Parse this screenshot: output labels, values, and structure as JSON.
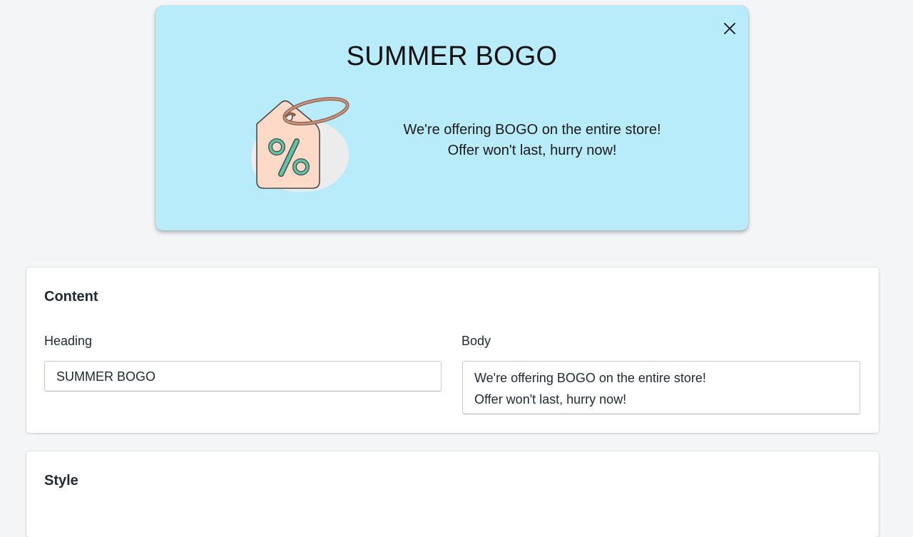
{
  "popup": {
    "heading": "SUMMER BOGO",
    "body_line1": "We're offering BOGO on the entire store!",
    "body_line2": "Offer won't last, hurry now!",
    "background_color": "#b8ecfb",
    "close_icon": "close-icon",
    "illustration_icon": "percent-price-tag-icon"
  },
  "content_card": {
    "title": "Content",
    "heading_label": "Heading",
    "heading_value": "SUMMER BOGO",
    "body_label": "Body",
    "body_value": "We're offering BOGO on the entire store!\nOffer won't last, hurry now!"
  },
  "style_card": {
    "title": "Style"
  }
}
